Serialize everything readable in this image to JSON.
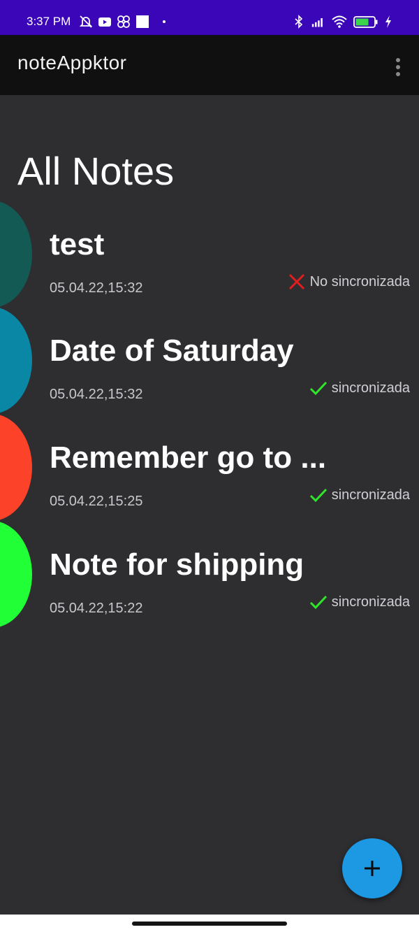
{
  "status_bar": {
    "time": "3:37 PM",
    "battery": "68",
    "icons": [
      "mute-icon",
      "youtube-icon",
      "pinwheel-icon",
      "square-icon",
      "dot-icon",
      "bluetooth-icon",
      "signal-icon",
      "wifi-icon",
      "battery-icon",
      "charging-icon"
    ]
  },
  "app_bar": {
    "title": "noteAppktor",
    "menu_icon": "more-vert-icon"
  },
  "page": {
    "title": "All Notes"
  },
  "notes": [
    {
      "title": "test",
      "date": "05.04.22,15:32",
      "sync_label": "No sincronizada",
      "synced": false,
      "color": "#135954"
    },
    {
      "title": "Date of Saturday",
      "date": "05.04.22,15:32",
      "sync_label": "sincronizada",
      "synced": true,
      "color": "#0a87a4"
    },
    {
      "title": "Remember go to ...",
      "date": "05.04.22,15:25",
      "sync_label": "sincronizada",
      "synced": true,
      "color": "#fc4329"
    },
    {
      "title": "Note for shipping",
      "date": "05.04.22,15:22",
      "sync_label": "sincronizada",
      "synced": true,
      "color": "#21ff37"
    }
  ],
  "fab": {
    "icon": "plus-icon"
  },
  "colors": {
    "status_bar": "#3a06b8",
    "app_bar": "#101011",
    "background": "#2e2d30",
    "fab": "#1d98e3",
    "synced": "#2fe62b",
    "not_synced": "#e21d1d"
  }
}
